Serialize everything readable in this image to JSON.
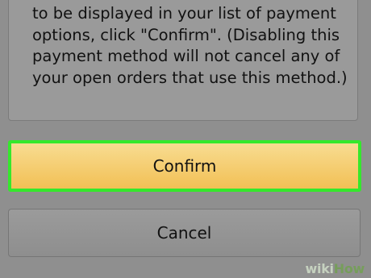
{
  "dialog": {
    "message_lines": [
      "to be displayed in your list of payment",
      "options, click \"Confirm\". (Disabling this",
      "payment method will not cancel any of",
      "your open orders that use this method.)"
    ]
  },
  "actions": {
    "confirm_label": "Confirm",
    "cancel_label": "Cancel",
    "highlight_color": "#35e82c",
    "confirm_color": "#f2c055"
  },
  "watermark": {
    "part1": "wiki",
    "part2": "How"
  }
}
